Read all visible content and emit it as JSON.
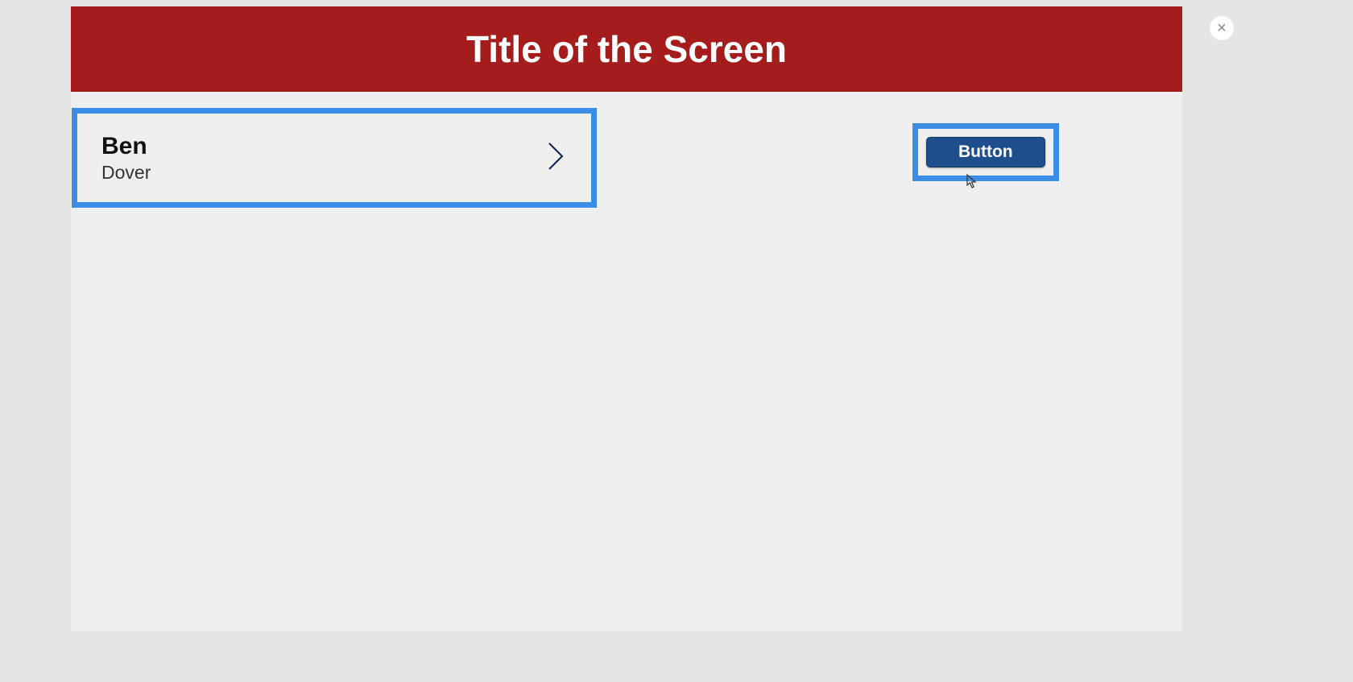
{
  "header": {
    "title": "Title of the Screen"
  },
  "item": {
    "primary": "Ben",
    "secondary": "Dover"
  },
  "button": {
    "label": "Button"
  },
  "close": {
    "label": "×"
  }
}
